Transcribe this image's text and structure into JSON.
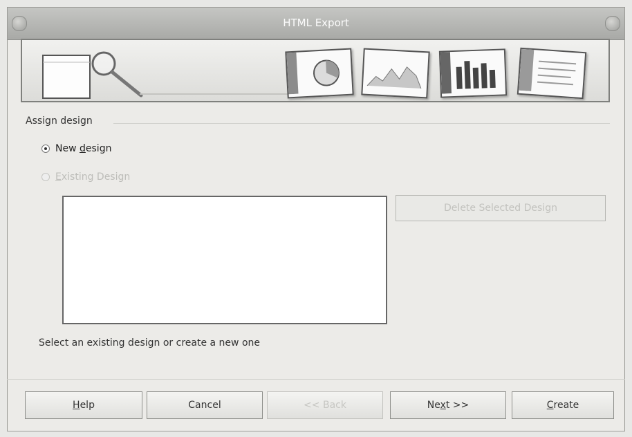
{
  "window": {
    "title": "HTML Export"
  },
  "assign_design": {
    "group_label": "Assign design",
    "new_design": {
      "label_prefix": "New ",
      "label_mnemonic": "d",
      "label_rest": "esign",
      "checked": true
    },
    "existing_design": {
      "label_mnemonic": "E",
      "label_rest": "xisting Design",
      "enabled": false
    }
  },
  "delete_button": {
    "label": "Delete Selected Design",
    "enabled": false
  },
  "hint": "Select an existing design or create a new one",
  "buttons": {
    "help": {
      "mnemonic": "H",
      "rest": "elp"
    },
    "cancel": {
      "label": "Cancel"
    },
    "back": {
      "label": "<< Back",
      "enabled": false
    },
    "next": {
      "prefix": "Ne",
      "mnemonic": "x",
      "rest": "t >>"
    },
    "create": {
      "mnemonic": "C",
      "rest": "reate"
    }
  }
}
